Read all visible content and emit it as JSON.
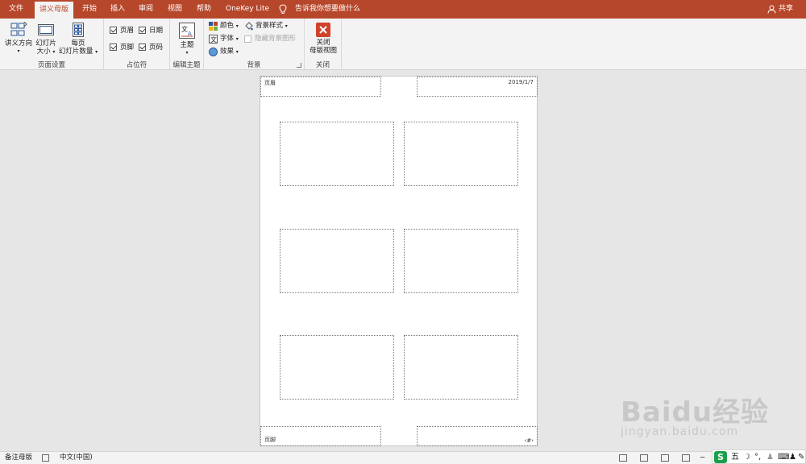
{
  "tabs": [
    {
      "label": "文件",
      "active": false
    },
    {
      "label": "讲义母版",
      "active": true
    },
    {
      "label": "开始",
      "active": false
    },
    {
      "label": "插入",
      "active": false
    },
    {
      "label": "审阅",
      "active": false
    },
    {
      "label": "视图",
      "active": false
    },
    {
      "label": "帮助",
      "active": false
    },
    {
      "label": "OneKey Lite",
      "active": false
    }
  ],
  "tell_me": "告诉我你想要做什么",
  "share": "共享",
  "ribbon": {
    "page_setup": {
      "label": "页面设置",
      "orientation": "讲义方向",
      "slide_size_1": "幻灯片",
      "slide_size_2": "大小",
      "per_page_1": "每页",
      "per_page_2": "幻灯片数量"
    },
    "placeholders": {
      "label": "占位符",
      "header": "页眉",
      "date": "日期",
      "footer": "页脚",
      "page_number": "页码"
    },
    "edit_theme": {
      "label": "编辑主题",
      "theme": "主题"
    },
    "background": {
      "label": "背景",
      "colors": "颜色",
      "fonts": "字体",
      "effects": "效果",
      "bg_styles": "背景样式",
      "hide_bg": "隐藏背景图形"
    },
    "close": {
      "label": "关闭",
      "close_1": "关闭",
      "close_2": "母版视图"
    }
  },
  "page": {
    "header": "页眉",
    "date": "2019/1/7",
    "footer": "页脚",
    "page_number": "‹#›"
  },
  "watermark": {
    "logo": "Baidu经验",
    "url": "jingyan.baidu.com"
  },
  "status": {
    "view": "备注母版",
    "language": "中文(中国)"
  },
  "ime": {
    "mode": "五"
  },
  "colors": {
    "accent": "#b7472a",
    "close_button": "#d0422c",
    "ime_green": "#19a04d"
  }
}
